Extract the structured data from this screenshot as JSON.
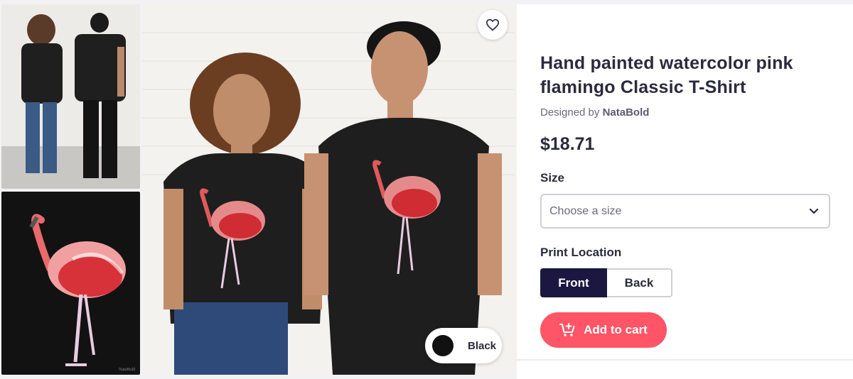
{
  "gallery": {
    "thumbnails": [
      {
        "icon": "model-back-view"
      },
      {
        "icon": "flamingo-design"
      }
    ],
    "main_image_icon": "models-wearing-shirt",
    "design_signature": "NataBold",
    "favorite_icon": "heart-icon",
    "color_selector": {
      "label": "Black",
      "swatch": "#111111"
    }
  },
  "product": {
    "title": "Hand painted watercolor pink flamingo Classic T-Shirt",
    "designer_prefix": "Designed by",
    "designer_name": "NataBold",
    "price": "$18.71",
    "size_label": "Size",
    "size_placeholder": "Choose a size",
    "print_location_label": "Print Location",
    "print_options": [
      "Front",
      "Back"
    ],
    "selected_print": "Front",
    "add_to_cart": "Add to cart"
  },
  "colors": {
    "accent": "#ff5566",
    "selected": "#1c1741",
    "text": "#2b2a3d"
  }
}
